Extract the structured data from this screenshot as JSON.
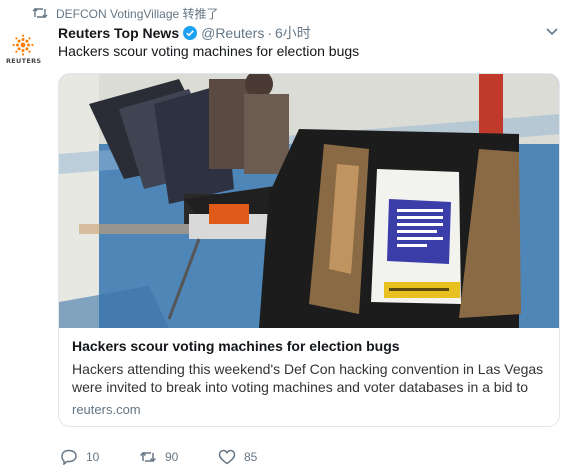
{
  "retweet_notice": {
    "text": "DEFCON VotingVillage 转推了",
    "icon": "retweet-icon"
  },
  "author": {
    "avatar_wordmark": "REUTERS",
    "name": "Reuters Top News",
    "verified_icon": "verified-badge-icon",
    "handle": "@Reuters",
    "separator": "·",
    "timestamp": "6小时"
  },
  "tweet": {
    "text": "Hackers scour voting machines for election bugs"
  },
  "card": {
    "image_subject": "voting machines",
    "title": "Hackers scour voting machines for election bugs",
    "description": "Hackers attending this weekend's Def Con hacking convention in Las Vegas were invited to break into voting machines and voter databases in a bid to",
    "domain": "reuters.com"
  },
  "actions": [
    {
      "icon": "reply-icon",
      "count": "10"
    },
    {
      "icon": "retweet-icon",
      "count": "90"
    },
    {
      "icon": "like-icon",
      "count": "85"
    }
  ],
  "colors": {
    "text": "#14171a",
    "secondary": "#657786",
    "verified": "#1da1f2",
    "border": "#e1e8ed",
    "reuters_orange": "#ff8000"
  }
}
